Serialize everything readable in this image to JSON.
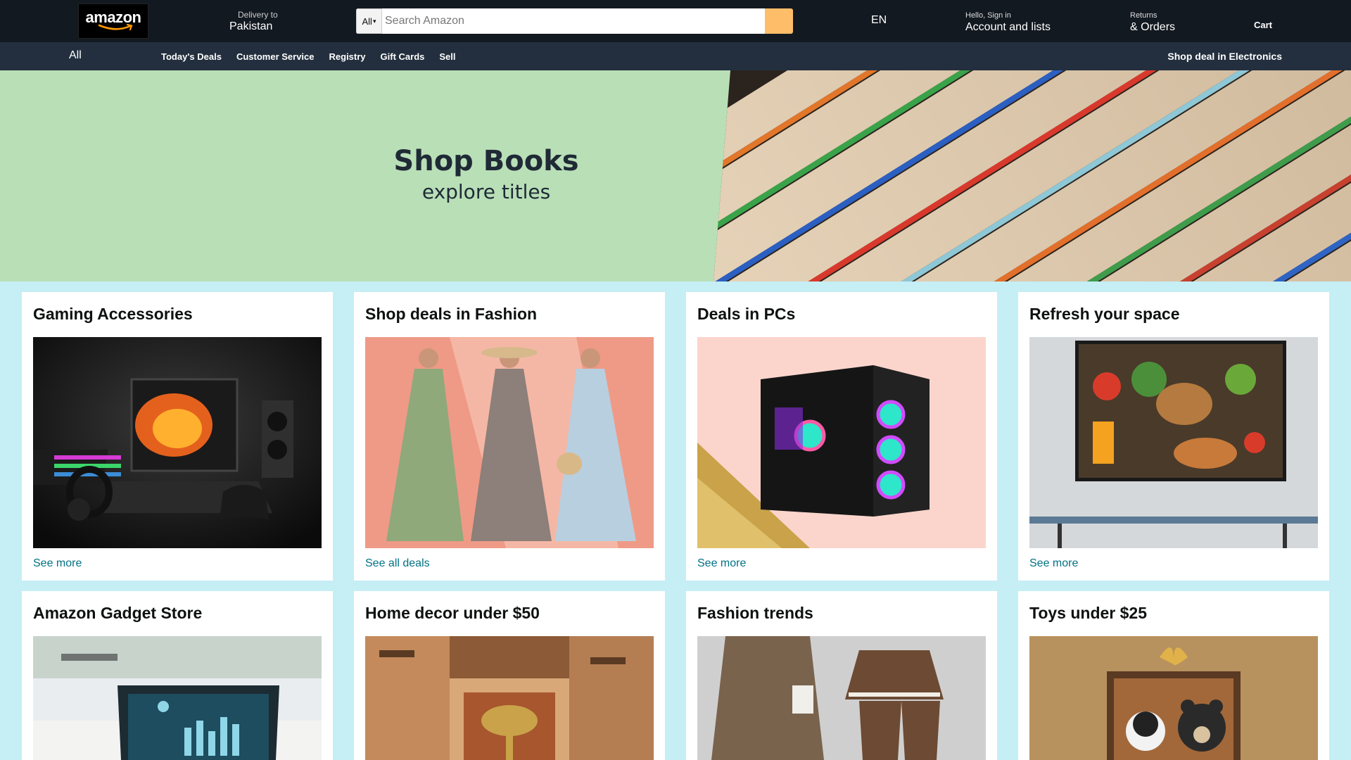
{
  "header": {
    "logo_text": "amazon",
    "delivery_label": "Delivery to",
    "delivery_location": "Pakistan",
    "search_category": "All",
    "search_placeholder": "Search Amazon",
    "language": "EN",
    "account_greeting": "Hello, Sign in",
    "account_label": "Account and lists",
    "returns_label": "Returns",
    "orders_label": "& Orders",
    "cart_label": "Cart"
  },
  "subnav": {
    "all_label": "All",
    "links": [
      "Today's Deals",
      "Customer Service",
      "Registry",
      "Gift Cards",
      "Sell"
    ],
    "promo": "Shop deal in Electronics"
  },
  "hero": {
    "title": "Shop Books",
    "subtitle": "explore titles"
  },
  "cards": [
    {
      "title": "Gaming Accessories",
      "link": "See more",
      "image": "gaming-accessories-image"
    },
    {
      "title": "Shop deals in Fashion",
      "link": "See all deals",
      "image": "fashion-dresses-image"
    },
    {
      "title": "Deals in PCs",
      "link": "See more",
      "image": "gaming-pc-image"
    },
    {
      "title": "Refresh your space",
      "link": "See more",
      "image": "wall-art-kitchen-image"
    },
    {
      "title": "Amazon Gadget Store",
      "link": "",
      "image": "laptop-dashboard-image"
    },
    {
      "title": "Home decor under $50",
      "link": "",
      "image": "boxes-lamp-image"
    },
    {
      "title": "Fashion trends",
      "link": "",
      "image": "knit-outfit-image"
    },
    {
      "title": "Toys under $25",
      "link": "",
      "image": "plush-toys-gift-image"
    }
  ],
  "colors": {
    "top_nav": "#131921",
    "sub_nav": "#232f3e",
    "search_button": "#febd69",
    "page_background": "#c6eef5",
    "hero_background": "#b9dfb7",
    "link": "#007185"
  }
}
